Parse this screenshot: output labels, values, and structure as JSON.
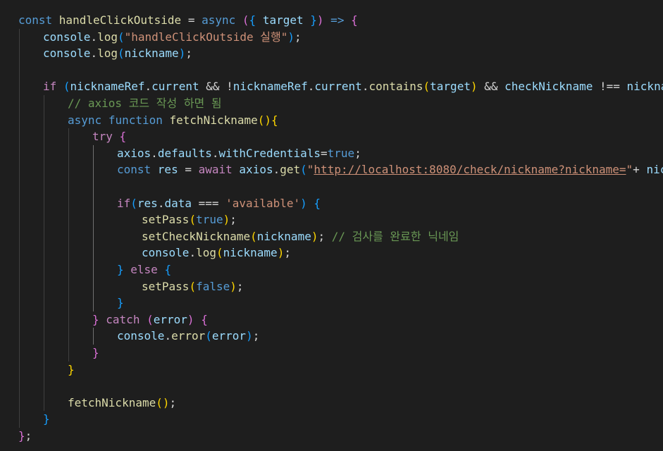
{
  "editor": {
    "language": "javascript",
    "theme": "dark",
    "colors": {
      "background": "#1e1e1e",
      "default": "#d4d4d4",
      "keyword": "#569cd6",
      "control": "#c586c0",
      "function": "#dcdcaa",
      "variable": "#9cdcfe",
      "string": "#ce9178",
      "comment": "#6a9955",
      "bracket1": "#ffd700",
      "bracket2": "#da70d6",
      "bracket3": "#179fff"
    },
    "lines": [
      {
        "indent": 0,
        "tokens": [
          [
            "const ",
            "keyword"
          ],
          [
            "handleClickOutside",
            "function"
          ],
          [
            " = ",
            "default"
          ],
          [
            "async",
            "keyword"
          ],
          [
            " ",
            "default"
          ],
          [
            "(",
            "bracket2"
          ],
          [
            "{",
            "bracket3"
          ],
          [
            " ",
            "default"
          ],
          [
            "target",
            "variable"
          ],
          [
            " ",
            "default"
          ],
          [
            "}",
            "bracket3"
          ],
          [
            ")",
            "bracket2"
          ],
          [
            " => ",
            "keyword"
          ],
          [
            "{",
            "bracket2"
          ]
        ]
      },
      {
        "indent": 1,
        "tokens": [
          [
            "console",
            "variable"
          ],
          [
            ".",
            "default"
          ],
          [
            "log",
            "function"
          ],
          [
            "(",
            "bracket3"
          ],
          [
            "\"handleClickOutside 실행\"",
            "string"
          ],
          [
            ")",
            "bracket3"
          ],
          [
            ";",
            "default"
          ]
        ]
      },
      {
        "indent": 1,
        "tokens": [
          [
            "console",
            "variable"
          ],
          [
            ".",
            "default"
          ],
          [
            "log",
            "function"
          ],
          [
            "(",
            "bracket3"
          ],
          [
            "nickname",
            "variable"
          ],
          [
            ")",
            "bracket3"
          ],
          [
            ";",
            "default"
          ]
        ]
      },
      {
        "indent": 0,
        "tokens": []
      },
      {
        "indent": 1,
        "tokens": [
          [
            "if",
            "control"
          ],
          [
            " ",
            "default"
          ],
          [
            "(",
            "bracket3"
          ],
          [
            "nicknameRef",
            "variable"
          ],
          [
            ".",
            "default"
          ],
          [
            "current",
            "variable"
          ],
          [
            " && !",
            "default"
          ],
          [
            "nicknameRef",
            "variable"
          ],
          [
            ".",
            "default"
          ],
          [
            "current",
            "variable"
          ],
          [
            ".",
            "default"
          ],
          [
            "contains",
            "function"
          ],
          [
            "(",
            "bracket1"
          ],
          [
            "target",
            "variable"
          ],
          [
            ")",
            "bracket1"
          ],
          [
            " && ",
            "default"
          ],
          [
            "checkNickname",
            "variable"
          ],
          [
            " !== ",
            "default"
          ],
          [
            "nickname",
            "variable"
          ],
          [
            ")",
            "bracket3"
          ],
          [
            " ",
            "default"
          ],
          [
            "{",
            "bracket3"
          ]
        ]
      },
      {
        "indent": 2,
        "tokens": [
          [
            "// axios 코드 작성 하면 됨",
            "comment"
          ]
        ]
      },
      {
        "indent": 2,
        "tokens": [
          [
            "async",
            "keyword"
          ],
          [
            " ",
            "default"
          ],
          [
            "function",
            "keyword"
          ],
          [
            " ",
            "default"
          ],
          [
            "fetchNickname",
            "function"
          ],
          [
            "()",
            "bracket1"
          ],
          [
            "{",
            "bracket1"
          ]
        ]
      },
      {
        "indent": 3,
        "tokens": [
          [
            "try",
            "control"
          ],
          [
            " ",
            "default"
          ],
          [
            "{",
            "bracket2"
          ]
        ]
      },
      {
        "indent": 4,
        "tokens": [
          [
            "axios",
            "variable"
          ],
          [
            ".",
            "default"
          ],
          [
            "defaults",
            "variable"
          ],
          [
            ".",
            "default"
          ],
          [
            "withCredentials",
            "variable"
          ],
          [
            "=",
            "default"
          ],
          [
            "true",
            "keyword"
          ],
          [
            ";",
            "default"
          ]
        ]
      },
      {
        "indent": 4,
        "tokens": [
          [
            "const ",
            "keyword"
          ],
          [
            "res",
            "variable"
          ],
          [
            " = ",
            "default"
          ],
          [
            "await",
            "control"
          ],
          [
            " ",
            "default"
          ],
          [
            "axios",
            "variable"
          ],
          [
            ".",
            "default"
          ],
          [
            "get",
            "function"
          ],
          [
            "(",
            "bracket3"
          ],
          [
            "\"",
            "string"
          ],
          [
            "http://localhost:8080/check/nickname?nickname=",
            "string-link"
          ],
          [
            "\"",
            "string"
          ],
          [
            "+ ",
            "default"
          ],
          [
            "nickname",
            "variable"
          ],
          [
            ")",
            "bracket3"
          ],
          [
            ";",
            "default"
          ]
        ]
      },
      {
        "indent": 0,
        "tokens": []
      },
      {
        "indent": 4,
        "tokens": [
          [
            "if",
            "control"
          ],
          [
            "(",
            "bracket3"
          ],
          [
            "res",
            "variable"
          ],
          [
            ".",
            "default"
          ],
          [
            "data",
            "variable"
          ],
          [
            " === ",
            "default"
          ],
          [
            "'available'",
            "string"
          ],
          [
            ")",
            "bracket3"
          ],
          [
            " ",
            "default"
          ],
          [
            "{",
            "bracket3"
          ]
        ]
      },
      {
        "indent": 5,
        "tokens": [
          [
            "setPass",
            "function"
          ],
          [
            "(",
            "bracket1"
          ],
          [
            "true",
            "keyword"
          ],
          [
            ")",
            "bracket1"
          ],
          [
            ";",
            "default"
          ]
        ]
      },
      {
        "indent": 5,
        "tokens": [
          [
            "setCheckNickname",
            "function"
          ],
          [
            "(",
            "bracket1"
          ],
          [
            "nickname",
            "variable"
          ],
          [
            ")",
            "bracket1"
          ],
          [
            "; ",
            "default"
          ],
          [
            "// 검사를 완료한 닉네임",
            "comment"
          ]
        ]
      },
      {
        "indent": 5,
        "tokens": [
          [
            "console",
            "variable"
          ],
          [
            ".",
            "default"
          ],
          [
            "log",
            "function"
          ],
          [
            "(",
            "bracket1"
          ],
          [
            "nickname",
            "variable"
          ],
          [
            ")",
            "bracket1"
          ],
          [
            ";",
            "default"
          ]
        ]
      },
      {
        "indent": 4,
        "tokens": [
          [
            "}",
            "bracket3"
          ],
          [
            " ",
            "default"
          ],
          [
            "else",
            "control"
          ],
          [
            " ",
            "default"
          ],
          [
            "{",
            "bracket3"
          ]
        ]
      },
      {
        "indent": 5,
        "tokens": [
          [
            "setPass",
            "function"
          ],
          [
            "(",
            "bracket1"
          ],
          [
            "false",
            "keyword"
          ],
          [
            ")",
            "bracket1"
          ],
          [
            ";",
            "default"
          ]
        ]
      },
      {
        "indent": 4,
        "tokens": [
          [
            "}",
            "bracket3"
          ]
        ]
      },
      {
        "indent": 3,
        "tokens": [
          [
            "}",
            "bracket2"
          ],
          [
            " ",
            "default"
          ],
          [
            "catch",
            "control"
          ],
          [
            " ",
            "default"
          ],
          [
            "(",
            "bracket2"
          ],
          [
            "error",
            "variable"
          ],
          [
            ")",
            "bracket2"
          ],
          [
            " ",
            "default"
          ],
          [
            "{",
            "bracket2"
          ]
        ]
      },
      {
        "indent": 4,
        "tokens": [
          [
            "console",
            "variable"
          ],
          [
            ".",
            "default"
          ],
          [
            "error",
            "function"
          ],
          [
            "(",
            "bracket3"
          ],
          [
            "error",
            "variable"
          ],
          [
            ")",
            "bracket3"
          ],
          [
            ";",
            "default"
          ]
        ]
      },
      {
        "indent": 3,
        "tokens": [
          [
            "}",
            "bracket2"
          ]
        ]
      },
      {
        "indent": 2,
        "tokens": [
          [
            "}",
            "bracket1"
          ]
        ]
      },
      {
        "indent": 0,
        "tokens": []
      },
      {
        "indent": 2,
        "tokens": [
          [
            "fetchNickname",
            "function"
          ],
          [
            "()",
            "bracket1"
          ],
          [
            ";",
            "default"
          ]
        ]
      },
      {
        "indent": 1,
        "tokens": [
          [
            "}",
            "bracket3"
          ]
        ]
      },
      {
        "indent": 0,
        "tokens": [
          [
            "}",
            "bracket2"
          ],
          [
            ";",
            "default"
          ]
        ]
      }
    ]
  }
}
